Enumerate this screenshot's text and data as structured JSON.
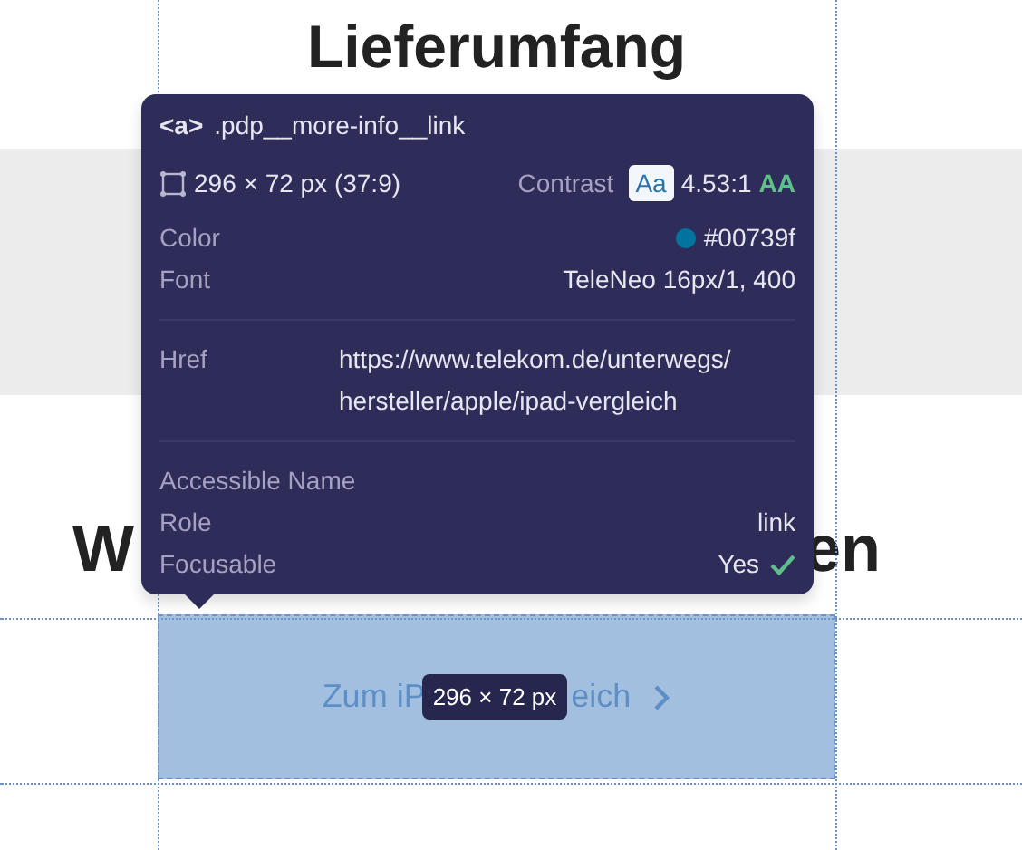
{
  "page": {
    "heading_top": "Lieferumfang",
    "heading_bottom_left": "W",
    "heading_bottom_right": "en",
    "link_text_left": "Zum iP",
    "link_text_right": "eich"
  },
  "size_badge": "296 × 72 px",
  "tooltip": {
    "tag": "<a>",
    "selector": ".pdp__more-info__link",
    "dimensions": "296 × 72 px (37:9)",
    "contrast_label": "Contrast",
    "contrast_sample": "Aa",
    "contrast_ratio": "4.53:1",
    "contrast_rating": "AA",
    "sections": [
      [
        {
          "kind": "color",
          "label": "Color",
          "value": "#00739f",
          "color": "#00739f"
        },
        {
          "kind": "text",
          "label": "Font",
          "value": "TeleNeo 16px/1, 400"
        }
      ],
      [
        {
          "kind": "link",
          "label": "Href",
          "value": "https://www.telekom.de/unterwegs/ hersteller/apple/ipad-vergleich"
        }
      ],
      [
        {
          "kind": "text",
          "label": "Accessible Name"
        },
        {
          "kind": "text",
          "label": "Role",
          "value": "link"
        },
        {
          "kind": "bool",
          "label": "Focusable",
          "value": "Yes",
          "checked": true
        }
      ]
    ]
  }
}
